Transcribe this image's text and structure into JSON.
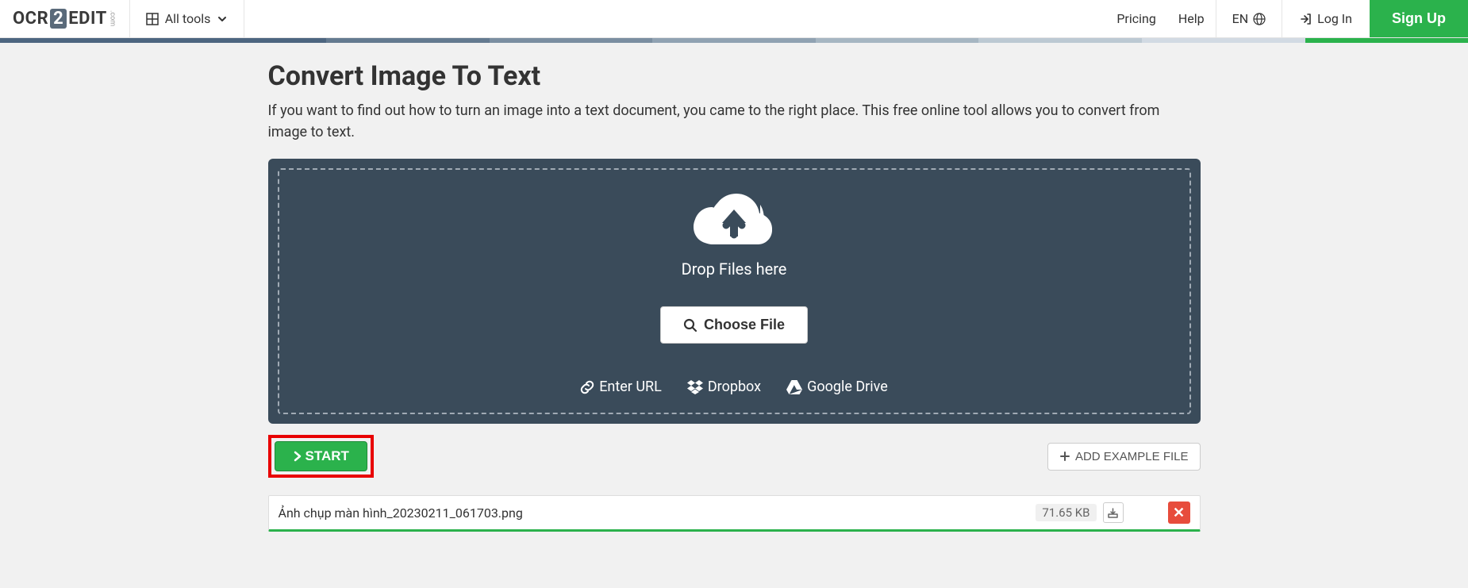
{
  "header": {
    "logo": {
      "part1": "OCR",
      "part2": "2",
      "part3": "EDIT",
      "sub": ".com"
    },
    "all_tools": "All tools",
    "links": {
      "pricing": "Pricing",
      "help": "Help"
    },
    "lang": "EN",
    "login": "Log In",
    "signup": "Sign Up"
  },
  "stripe_colors": [
    "#4d6680",
    "#4d6680",
    "#647a90",
    "#7a8ea1",
    "#90a2b2",
    "#a6b6c2",
    "#bcc9d3",
    "#d2dae3",
    "#2bb24c"
  ],
  "page": {
    "title": "Convert Image To Text",
    "desc": "If you want to find out how to turn an image into a text document, you came to the right place. This free online tool allows you to convert from image to text."
  },
  "dropzone": {
    "drop_text": "Drop Files here",
    "choose_file": "Choose File",
    "enter_url": "Enter URL",
    "dropbox": "Dropbox",
    "gdrive": "Google Drive"
  },
  "actions": {
    "start": "START",
    "add_example": "ADD EXAMPLE FILE"
  },
  "file": {
    "name": "Ảnh chụp màn hình_20230211_061703.png",
    "size": "71.65 KB"
  }
}
